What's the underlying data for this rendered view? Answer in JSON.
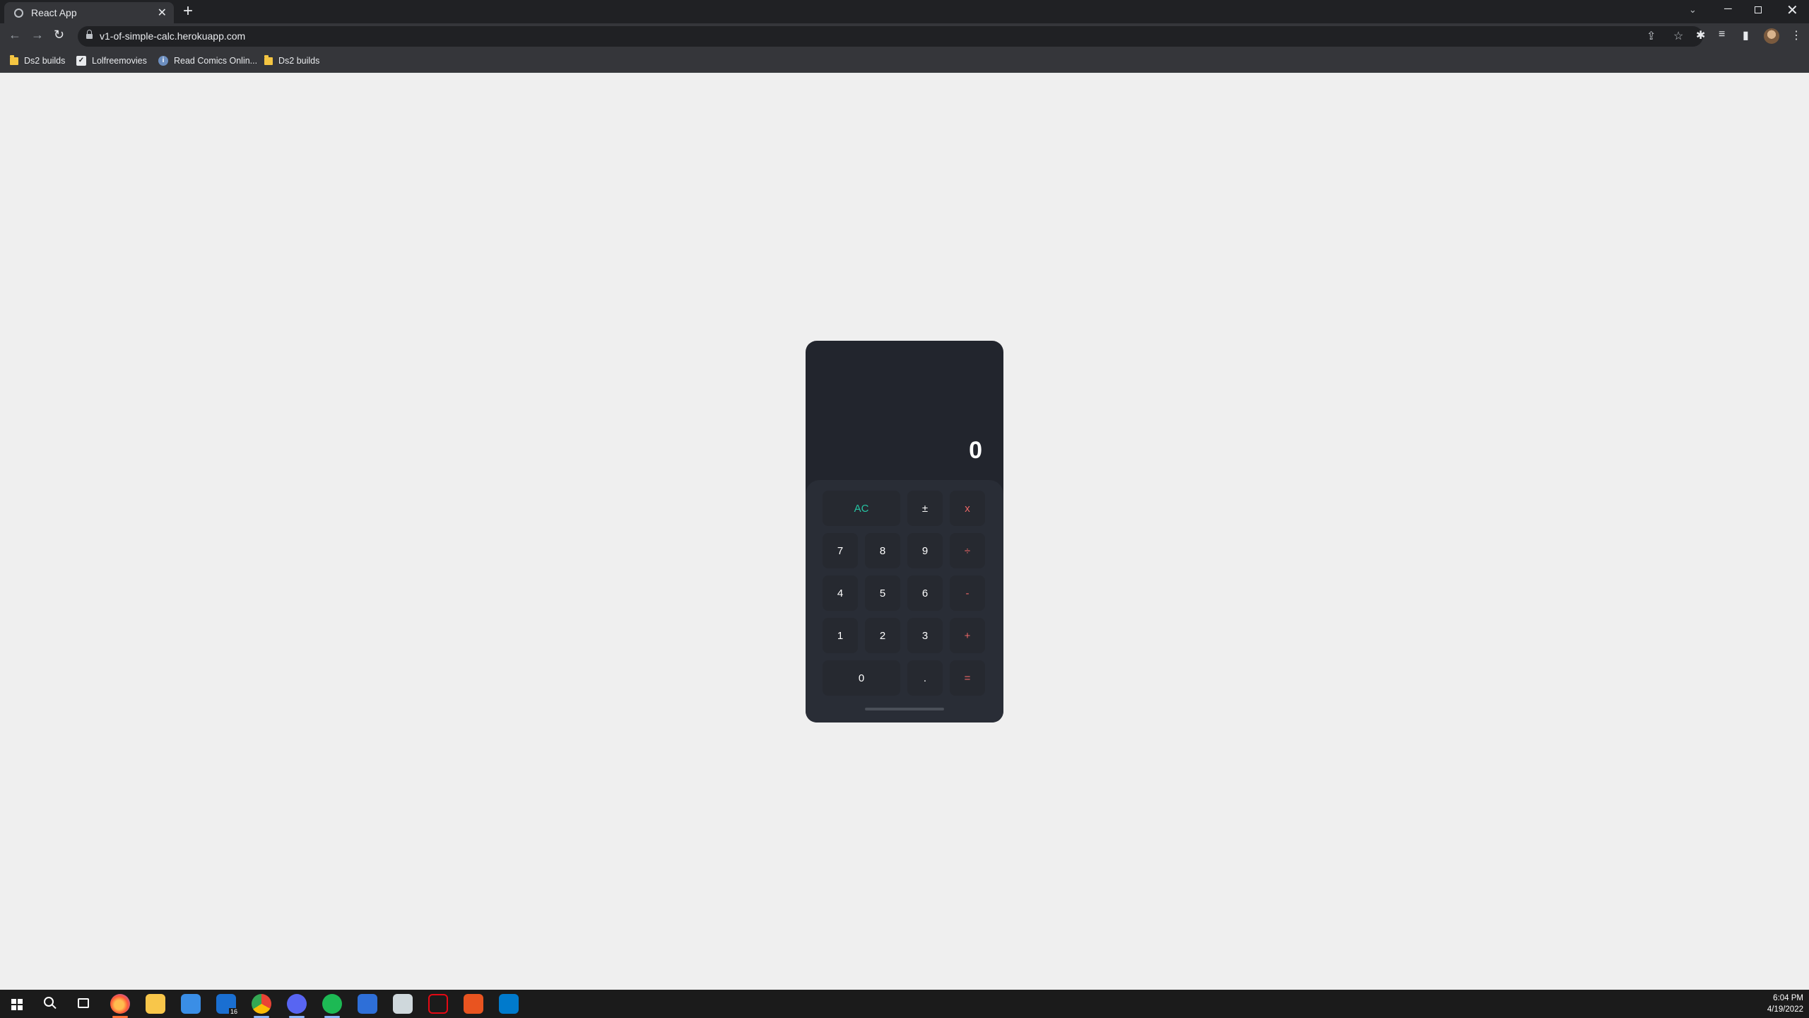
{
  "browser": {
    "tab_title": "React App",
    "tab_close": "✕",
    "new_tab": "+",
    "url": "v1-of-simple-calc.herokuapp.com",
    "bookmarks": [
      "Ds2 builds",
      "Lolfreemovies",
      "Read Comics Onlin...",
      "Ds2 builds"
    ]
  },
  "calculator": {
    "display": "0",
    "keys": {
      "ac": "AC",
      "plus_minus": "±",
      "multiply": "x",
      "seven": "7",
      "eight": "8",
      "nine": "9",
      "divide": "÷",
      "four": "4",
      "five": "5",
      "six": "6",
      "minus": "-",
      "one": "1",
      "two": "2",
      "three": "3",
      "plus": "+",
      "zero": "0",
      "decimal": ".",
      "equals": "="
    },
    "colors": {
      "function_key": "#26c4a3",
      "operator_key": "#eb6666",
      "body": "#22252d"
    }
  },
  "taskbar": {
    "time": "6:04 PM",
    "date": "4/19/2022",
    "mail_badge": "16"
  },
  "icons": {
    "tab_favicon": "globe-icon",
    "back": "←",
    "forward": "→",
    "reload": "↻",
    "share": "⇪",
    "star": "☆",
    "extensions": "✱",
    "reading_list": "≡",
    "side_panel": "▮",
    "menu": "⋮",
    "tab_search": "⌄",
    "minimize": "─",
    "close_window": "✕",
    "bm_lolfree": "✓",
    "bm_comics": "i"
  }
}
